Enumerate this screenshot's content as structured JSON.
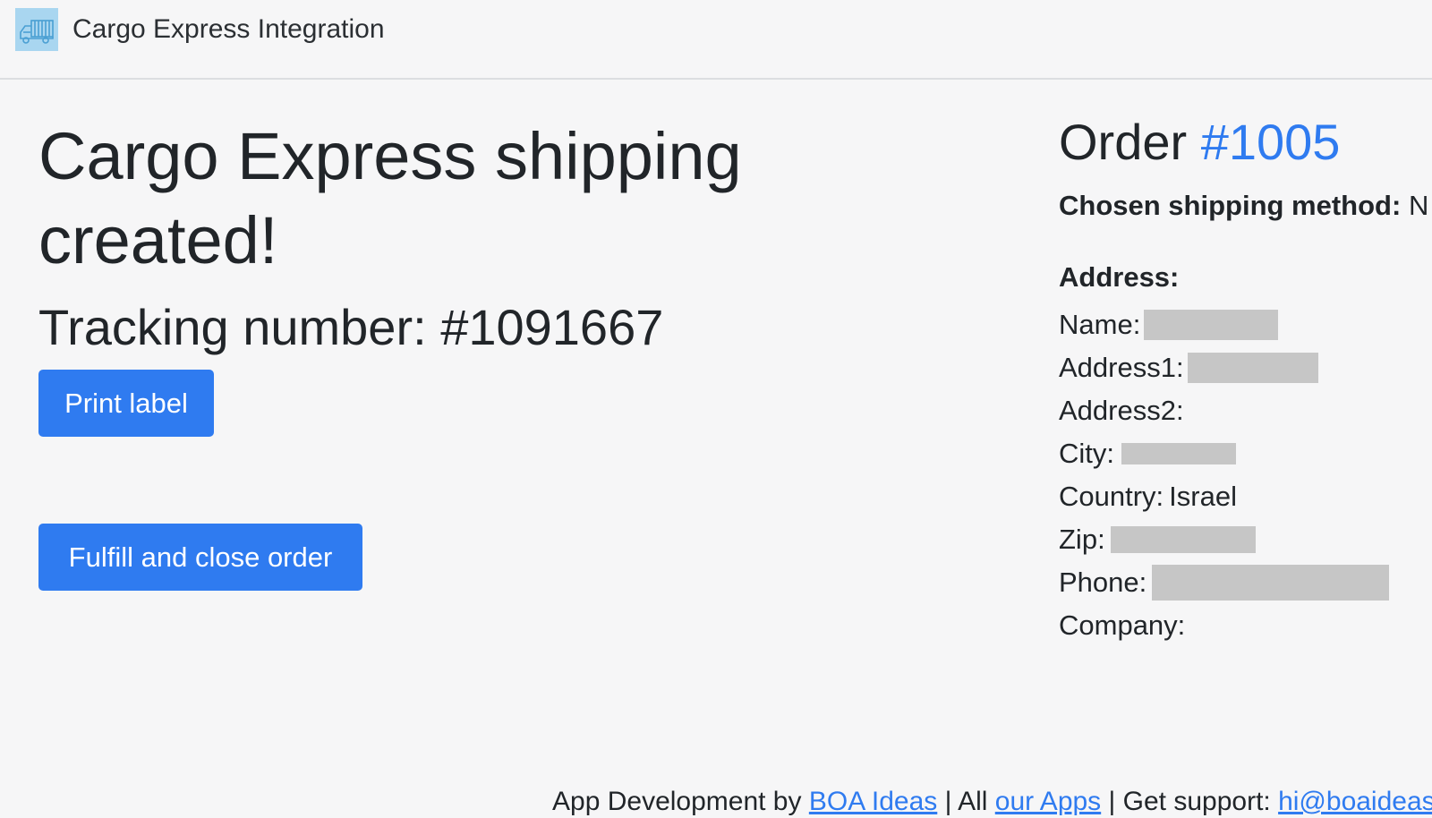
{
  "header": {
    "app_title": "Cargo Express Integration",
    "logo_icon": "truck-icon"
  },
  "main": {
    "heading": "Cargo Express shipping created!",
    "tracking_text": "Tracking number: #1091667",
    "print_label_button": "Print label",
    "fulfill_button": "Fulfill and close order"
  },
  "order": {
    "title_prefix": "Order",
    "order_number": "#1005",
    "shipping_method_label": "Chosen shipping method:",
    "shipping_method_value": "N",
    "address_heading": "Address:",
    "fields": {
      "name_label": "Name:",
      "address1_label": "Address1:",
      "address2_label": "Address2:",
      "city_label": "City:",
      "country_label": "Country:",
      "country_value": "Israel",
      "zip_label": "Zip:",
      "phone_label": "Phone:",
      "company_label": "Company:"
    }
  },
  "footer": {
    "prefix": "App Development by ",
    "boa_link": "BOA Ideas",
    "sep1": " | All ",
    "apps_link": "our Apps",
    "sep2": " | Get support: ",
    "support_link": "hi@boaideas"
  },
  "colors": {
    "accent": "#2f7bf0",
    "background": "#f6f6f7",
    "redacted": "#c6c6c6"
  }
}
